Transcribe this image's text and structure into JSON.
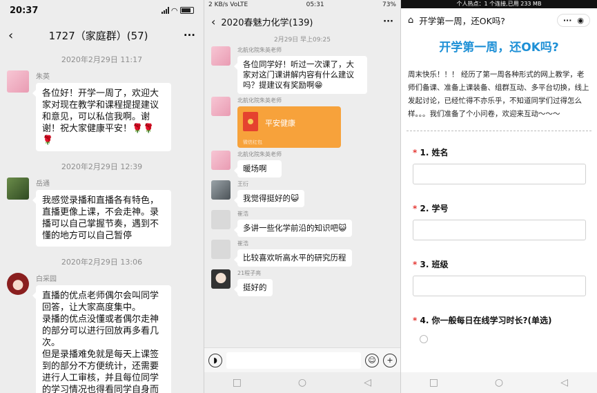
{
  "p1": {
    "time": "20:37",
    "title": "1727（家庭群）(57)",
    "messages": [
      {
        "ts": "2020年2月29日 11:17",
        "sender": "朱英",
        "text": "各位好！开学一周了，欢迎大家对现在教学和课程提提建议和意见，可以私信我啊。谢谢！祝大家健康平安！🌹🌹🌹"
      },
      {
        "ts": "2020年2月29日 12:39",
        "sender": "岳通",
        "text": "我感觉录播和直播各有特色，直播更像上课，不会走神。录播可以自己掌握节奏，遇到不懂的地方可以自己暂停"
      },
      {
        "ts": "2020年2月29日 13:06",
        "sender": "白采园",
        "text": "直播的优点老师偶尔会叫同学回答，让大家高度集中。\n录播的优点没懂或者偶尔走神的部分可以进行回放再多看几次。\n但是录播难免就是每天上课签到的部分不方便统计，还需要进行人工审核，并且每位同学的学习情况也得看同学自身而定。总之各有利弊"
      }
    ]
  },
  "p2": {
    "status_left": "2 KB/s VoLTE",
    "time": "05:31",
    "battery": "73%",
    "title": "2020春魅力化学(139)",
    "ts": "2月29日 早上09:25",
    "messages": [
      {
        "sender": "北航化院朱英老师",
        "text": "各位同学好！听过一次课了，大家对这门课讲解内容有什么建议吗？提建议有奖励啊😁"
      },
      {
        "sender": "北航化院朱英老师",
        "redpacket_title": "平安健康",
        "redpacket_foot": "微信红包"
      },
      {
        "sender": "北航化院朱英老师",
        "text": "暖场啊"
      },
      {
        "sender": "王衍",
        "text": "我觉得挺好的😺"
      },
      {
        "sender": "崔浩",
        "text": "多讲一些化学前沿的知识吧😺"
      },
      {
        "sender": "崔浩",
        "text": "比较喜欢听高水平的研究历程"
      },
      {
        "sender": "21程子亮",
        "text": "挺好的"
      }
    ]
  },
  "p3": {
    "status": "个人热点：1 个连接,已用 233 MB",
    "nav_title": "开学第一周，还OK吗?",
    "title": "开学第一周，还OK吗?",
    "desc": "周末快乐！！！ 经历了第一周各种形式的网上教学，老师们备课、准备上课装备、组群互动、多平台切换，线上发起讨论，已经忙得不亦乐乎，不知道同学们过得怎么样。。。我们准备了个小问卷，欢迎来互动～～～",
    "questions": [
      "1. 姓名",
      "2. 学号",
      "3. 班级",
      "4. 你一般每日在线学习时长?(单选)"
    ]
  },
  "colors": {
    "accent": "#1e90d6",
    "required": "#e53935",
    "redpacket": "#f7a23b"
  }
}
